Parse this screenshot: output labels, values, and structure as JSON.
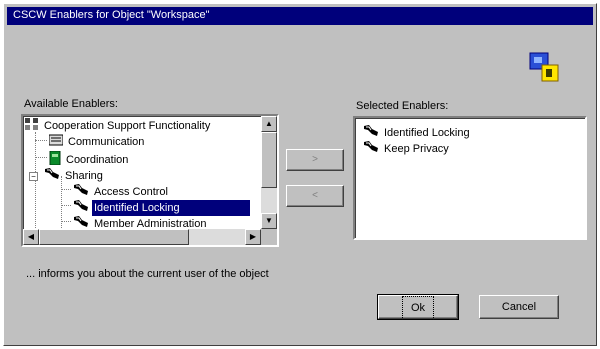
{
  "window": {
    "title": "CSCW Enablers for Object \"Workspace\""
  },
  "available": {
    "label": "Available Enablers:",
    "items": [
      {
        "label": "Cooperation Support Functionality",
        "icon": "cooperation-icon"
      },
      {
        "label": "Communication",
        "icon": "communication-icon"
      },
      {
        "label": "Coordination",
        "icon": "coordination-icon"
      },
      {
        "label": "Sharing",
        "icon": "enabler-icon",
        "expander": "−"
      },
      {
        "label": "Access Control",
        "icon": "enabler-icon"
      },
      {
        "label": "Identified Locking",
        "icon": "enabler-icon"
      },
      {
        "label": "Member Administration",
        "icon": "enabler-icon"
      }
    ]
  },
  "selected": {
    "label": "Selected Enablers:",
    "items": [
      {
        "label": "Identified Locking",
        "icon": "enabler-icon"
      },
      {
        "label": "Keep Privacy",
        "icon": "enabler-icon"
      }
    ]
  },
  "buttons": {
    "add": ">",
    "remove": "<",
    "ok": "Ok",
    "cancel": "Cancel"
  },
  "description": "... informs you about the current user of the object",
  "colors": {
    "dialog_bg": "#c0c0c0",
    "title_bg": "#00007b",
    "selection_bg": "#00007b"
  }
}
